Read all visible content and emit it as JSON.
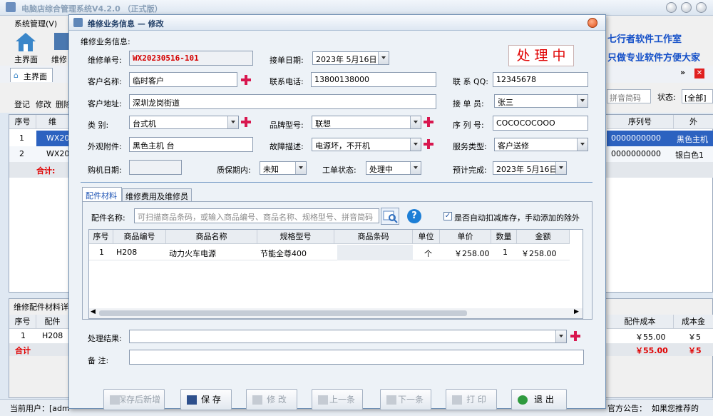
{
  "app": {
    "title": "电脑店综合管理系统V4.2.0  （正式版）"
  },
  "menubar": {
    "items": [
      "系统管理(V)"
    ]
  },
  "toolbar": {
    "home": "主界面",
    "repair": "维修"
  },
  "tabs": {
    "home": "主界面"
  },
  "bg_actions": [
    "登记",
    "修改",
    "删除"
  ],
  "bg_filter": {
    "pinyin_placeholder": "拼音简码",
    "status_label": "状态:",
    "status_value": "[全部]"
  },
  "brand": {
    "line1": "七行者软件工作室",
    "line2": "只做专业软件方便大家"
  },
  "bg_table": {
    "headers": [
      "序号",
      "维",
      "序列号",
      "外"
    ],
    "rows": [
      {
        "no": "1",
        "id": "WX20",
        "serial": "0000000000",
        "ext": "黑色主机"
      },
      {
        "no": "2",
        "id": "WX20",
        "serial": "0000000000",
        "ext": "银白色1"
      }
    ],
    "total": "合计:"
  },
  "bg_parts": {
    "title": "维修配件材料详",
    "headers": [
      "序号",
      "配件",
      "配件成本",
      "成本金"
    ],
    "row": {
      "no": "1",
      "code": "H208",
      "cost": "￥55.00",
      "amount": "￥5"
    },
    "total_label": "合计",
    "total_cost": "￥55.00",
    "total_amount": "￥5"
  },
  "statusbar": {
    "user": "当前用户：[adm",
    "notice": "官方公告：",
    "marquee": "如果您推荐的"
  },
  "dialog": {
    "title": "维修业务信息 — 修改",
    "section": "维修业务信息:",
    "status_stamp": "处 理 中",
    "fields": {
      "order_no_label": "维修单号:",
      "order_no": "WX20230516-101",
      "date_label": "接单日期:",
      "date": "2023年 5月16日",
      "customer_label": "客户名称:",
      "customer": "临时客户",
      "phone_label": "联系电话:",
      "phone": "13800138000",
      "qq_label": "联 系 QQ:",
      "qq": "12345678",
      "address_label": "客户地址:",
      "address": "深圳龙岗街道",
      "handler_label": "接 单 员:",
      "handler": "张三",
      "category_label": "类    别:",
      "category": "台式机",
      "brand_label": "品牌型号:",
      "brand": "联想",
      "serial_label": "序 列 号:",
      "serial": "COCOCOCOOO",
      "accessory_label": "外观附件:",
      "accessory": "黑色主机  台",
      "fault_label": "故障描述:",
      "fault": "电源坏，不开机",
      "service_label": "服务类型:",
      "service": "客户送修",
      "purchase_label": "购机日期:",
      "purchase": "",
      "warranty_label": "质保期内:",
      "warranty": "未知",
      "workstatus_label": "工单状态:",
      "workstatus": "处理中",
      "estimate_label": "预计完成:",
      "estimate": "2023年 5月16日"
    },
    "tabs": [
      "配件材料",
      "维修费用及维修员"
    ],
    "parts_search_label": "配件名称:",
    "parts_search_placeholder": "可扫描商品条码，或输入商品编号、商品名称、规格型号、拼音简码",
    "auto_deduct": "是否自动扣减库存，手动添加的除外",
    "parts_headers": [
      "序号",
      "商品编号",
      "商品名称",
      "规格型号",
      "商品条码",
      "单位",
      "单价",
      "数量",
      "金额"
    ],
    "parts_rows": [
      {
        "no": "1",
        "code": "H208",
        "name": "动力火车电源",
        "spec": "节能全尊400",
        "barcode": "",
        "unit": "个",
        "price": "￥258.00",
        "qty": "1",
        "amount": "￥258.00"
      }
    ],
    "result_label": "处理结果:",
    "result": "",
    "remark_label": "备    注:",
    "remark": "",
    "buttons": [
      "保存后新增",
      "保 存",
      "修 改",
      "上一条",
      "下一条",
      "打 印",
      "退 出"
    ]
  }
}
